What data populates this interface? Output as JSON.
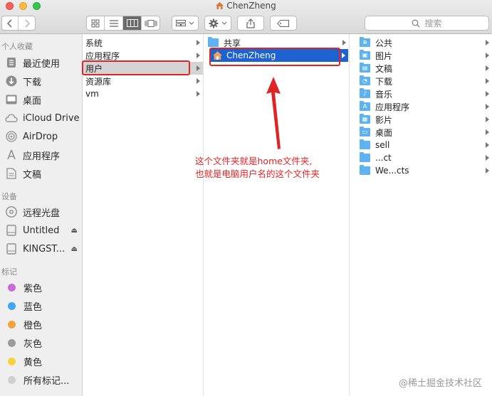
{
  "window": {
    "title": "ChenZheng",
    "search_placeholder": "搜索"
  },
  "sidebar": {
    "favorites_header": "个人收藏",
    "favorites": [
      {
        "label": "最近使用",
        "icon": "recents-icon"
      },
      {
        "label": "下载",
        "icon": "download-icon"
      },
      {
        "label": "桌面",
        "icon": "desktop-icon"
      },
      {
        "label": "iCloud Drive",
        "icon": "cloud-icon"
      },
      {
        "label": "AirDrop",
        "icon": "airdrop-icon"
      },
      {
        "label": "应用程序",
        "icon": "applications-icon"
      },
      {
        "label": "文稿",
        "icon": "documents-icon"
      }
    ],
    "devices_header": "设备",
    "devices": [
      {
        "label": "远程光盘",
        "icon": "disc-icon"
      },
      {
        "label": "Untitled",
        "icon": "drive-icon"
      },
      {
        "label": "KINGST...",
        "icon": "drive-icon"
      }
    ],
    "tags_header": "标记",
    "tags": [
      {
        "label": "紫色",
        "color": "#c86dd7"
      },
      {
        "label": "蓝色",
        "color": "#3fa5f5"
      },
      {
        "label": "橙色",
        "color": "#f5a33b"
      },
      {
        "label": "灰色",
        "color": "#9b9b9b"
      },
      {
        "label": "黄色",
        "color": "#f5d33b"
      },
      {
        "label": "所有标记...",
        "color": "#cfcfcf"
      }
    ]
  },
  "columns": {
    "col1": [
      "系统",
      "应用程序",
      "用户",
      "资源库",
      "vm"
    ],
    "col2": [
      "共享",
      "ChenZheng"
    ],
    "col3": [
      {
        "label": "公共",
        "icon": "public-folder-icon"
      },
      {
        "label": "图片",
        "icon": "pictures-folder-icon"
      },
      {
        "label": "文稿",
        "icon": "documents-folder-icon"
      },
      {
        "label": "下载",
        "icon": "downloads-folder-icon"
      },
      {
        "label": "音乐",
        "icon": "music-folder-icon"
      },
      {
        "label": "应用程序",
        "icon": "apps-folder-icon"
      },
      {
        "label": "影片",
        "icon": "movies-folder-icon"
      },
      {
        "label": "桌面",
        "icon": "desktop-folder-icon"
      },
      {
        "label": "sell",
        "icon": "folder-icon"
      },
      {
        "label": "...ct",
        "icon": "folder-icon"
      },
      {
        "label": "We...cts",
        "icon": "folder-icon"
      }
    ]
  },
  "annotation": {
    "line1": "这个文件夹就是home文件夹,",
    "line2": "也就是电脑用户名的这个文件夹",
    "color": "#e02424"
  },
  "watermark": "@稀土掘金技术社区"
}
